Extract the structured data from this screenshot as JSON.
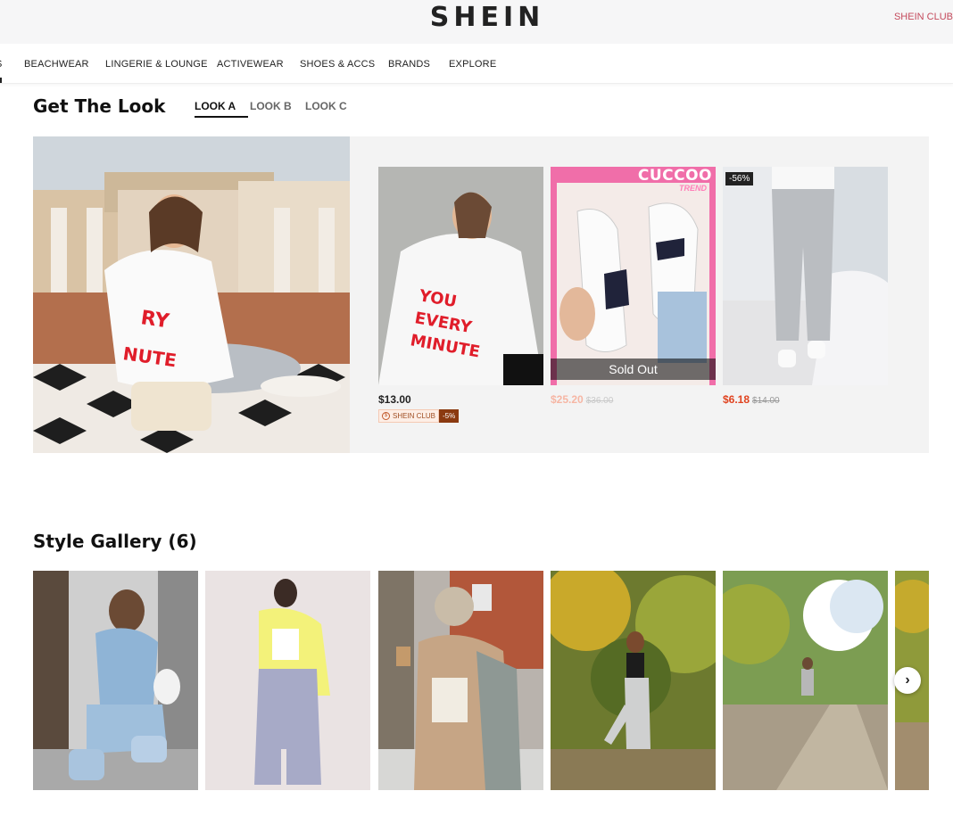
{
  "header": {
    "logo": "SHEIN",
    "club_link": "SHEIN CLUB"
  },
  "nav": {
    "cut_item": "S",
    "items": [
      "BEACHWEAR",
      "LINGERIE & LOUNGE",
      "ACTIVEWEAR",
      "SHOES & ACCS",
      "BRANDS",
      "EXPLORE"
    ]
  },
  "get_the_look": {
    "title": "Get The Look",
    "tabs": [
      "LOOK A",
      "LOOK B",
      "LOOK C"
    ],
    "active_tab": "LOOK A",
    "products": [
      {
        "price": "$13.00",
        "club_label": "SHEIN CLUB",
        "club_discount": "-5%"
      },
      {
        "price": "$25.20",
        "original_price": "$36.00",
        "brand": "CUCCOO",
        "brand_sub": "TREND",
        "status": "Sold Out"
      },
      {
        "price": "$6.18",
        "original_price": "$14.00",
        "discount": "-56%"
      }
    ]
  },
  "style_gallery": {
    "title": "Style Gallery (6)",
    "count": 6
  },
  "colors": {
    "accent_red": "#e0431f",
    "club_pink": "#c44a5c",
    "cuccoo_pink": "#f06ea9"
  }
}
